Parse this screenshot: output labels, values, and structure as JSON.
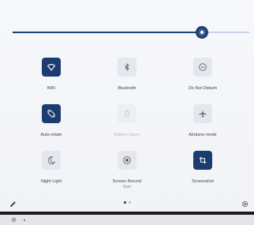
{
  "brightness": {
    "level": 0.8
  },
  "tiles": [
    {
      "label": "WiFi",
      "icon": "wifi-icon",
      "state": "on"
    },
    {
      "label": "Bluetooth",
      "icon": "bluetooth-icon",
      "state": "off"
    },
    {
      "label": "Do Not Disturb",
      "icon": "do-not-disturb-icon",
      "state": "off"
    },
    {
      "label": "Auto-rotate",
      "icon": "auto-rotate-icon",
      "state": "on"
    },
    {
      "label": "Battery Saver",
      "icon": "battery-icon",
      "state": "disabled"
    },
    {
      "label": "Airplane mode",
      "icon": "airplane-icon",
      "state": "off"
    },
    {
      "label": "Night Light",
      "icon": "night-light-icon",
      "state": "off"
    },
    {
      "label": "Screen Record",
      "sublabel": "Start",
      "icon": "screen-record-icon",
      "state": "off"
    },
    {
      "label": "Screenshot",
      "icon": "screenshot-icon",
      "state": "on"
    }
  ],
  "pagination": {
    "pages": 2,
    "current": 1
  },
  "colors": {
    "accent": "#1b3c6f",
    "tile_off": "#e4e7ee",
    "icon_off": "#5f6470"
  }
}
